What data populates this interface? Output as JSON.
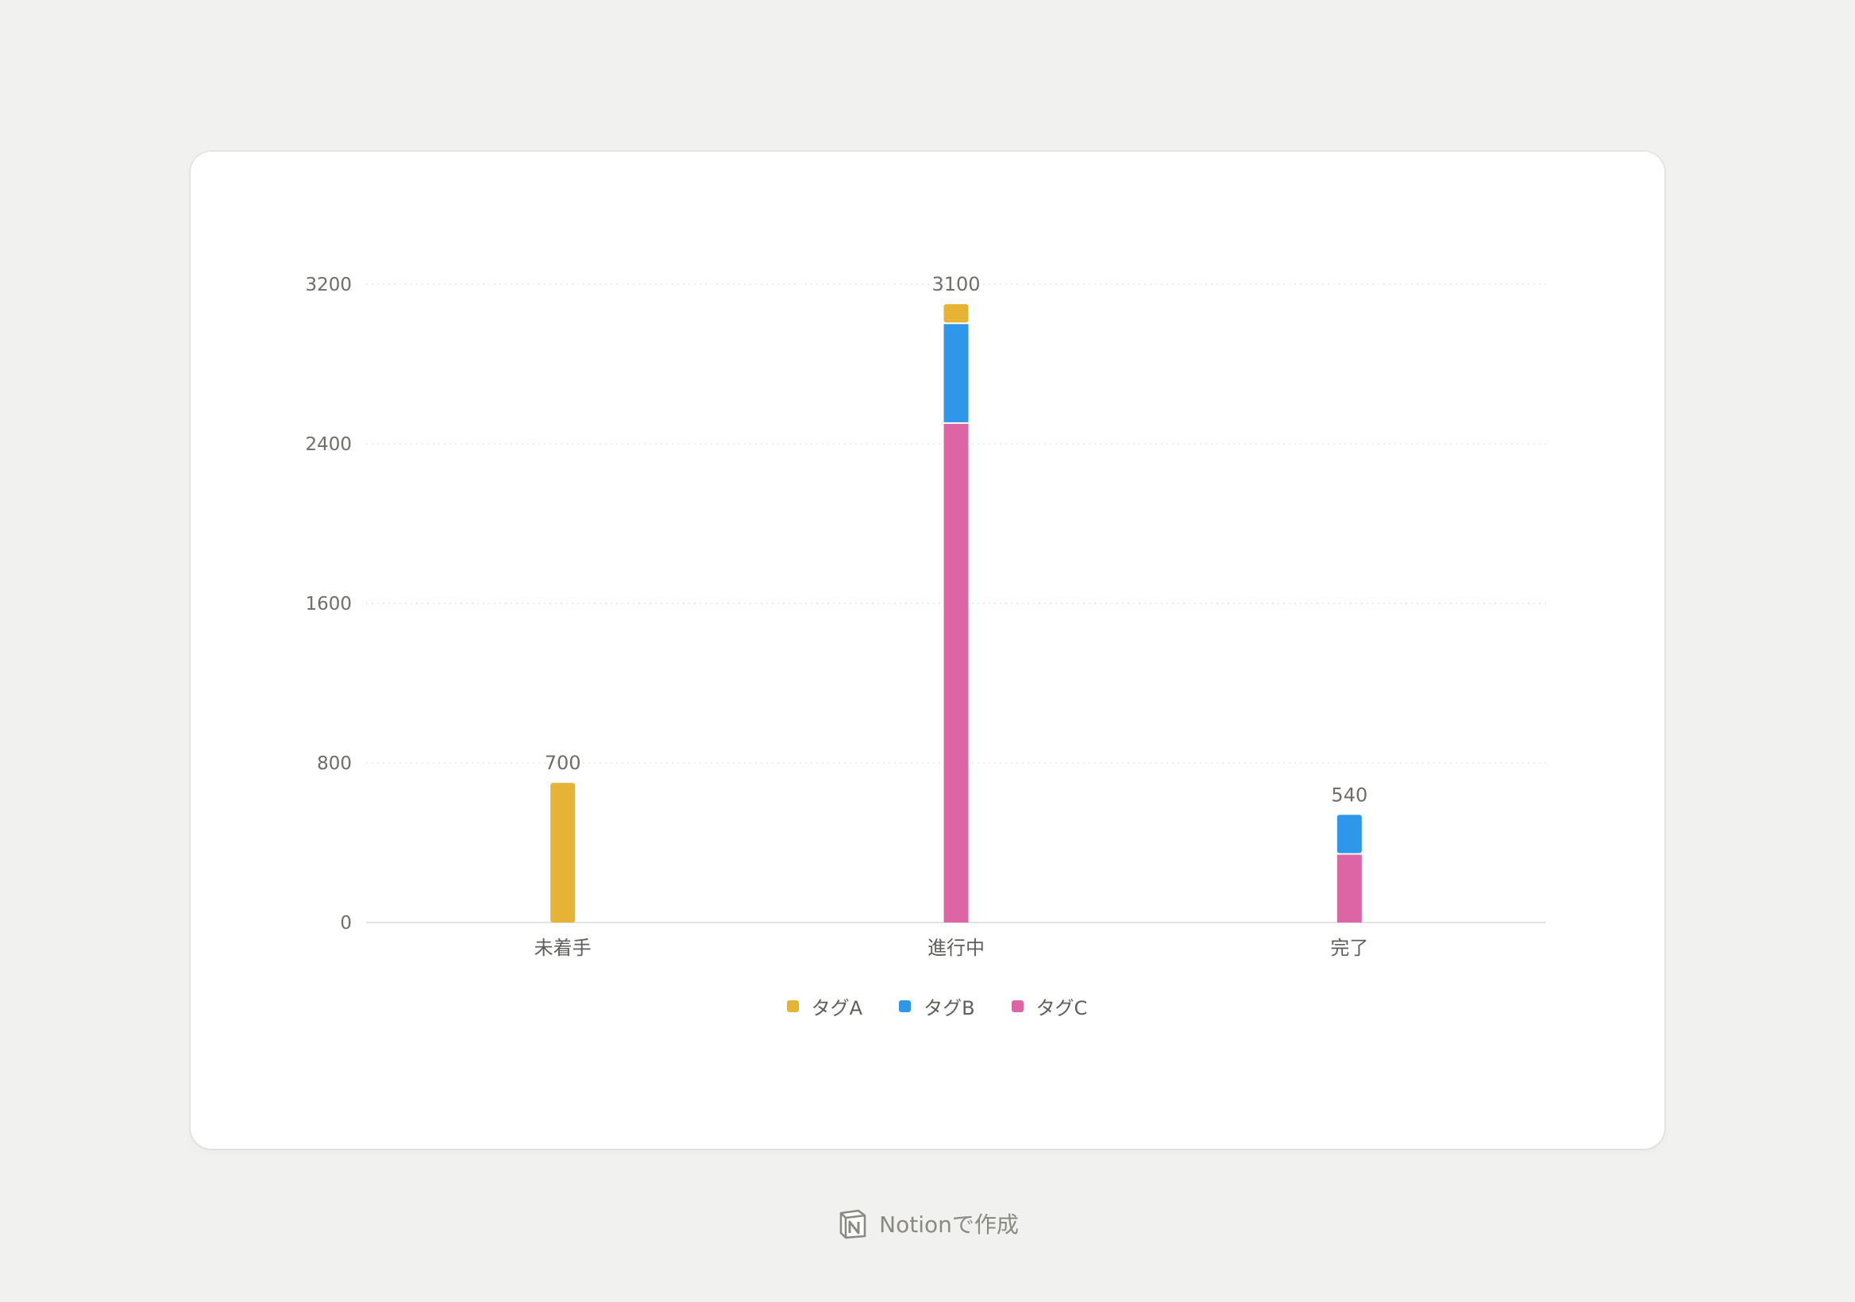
{
  "chart_data": {
    "type": "bar",
    "stacked": true,
    "categories": [
      "未着手",
      "進行中",
      "完了"
    ],
    "series": [
      {
        "name": "タグA",
        "color": "#e6b334",
        "values": [
          700,
          100,
          0
        ]
      },
      {
        "name": "タグB",
        "color": "#2f97ea",
        "values": [
          0,
          500,
          200
        ]
      },
      {
        "name": "タグC",
        "color": "#dd65a5",
        "values": [
          0,
          2500,
          340
        ]
      }
    ],
    "totals": [
      700,
      3100,
      540
    ],
    "yticks": [
      0,
      800,
      1600,
      2400,
      3200
    ],
    "ylim": [
      0,
      3200
    ],
    "grid": true,
    "legend_position": "bottom-center"
  },
  "footer": {
    "text": "Notionで作成",
    "logo_icon": "notion-logo-icon"
  }
}
